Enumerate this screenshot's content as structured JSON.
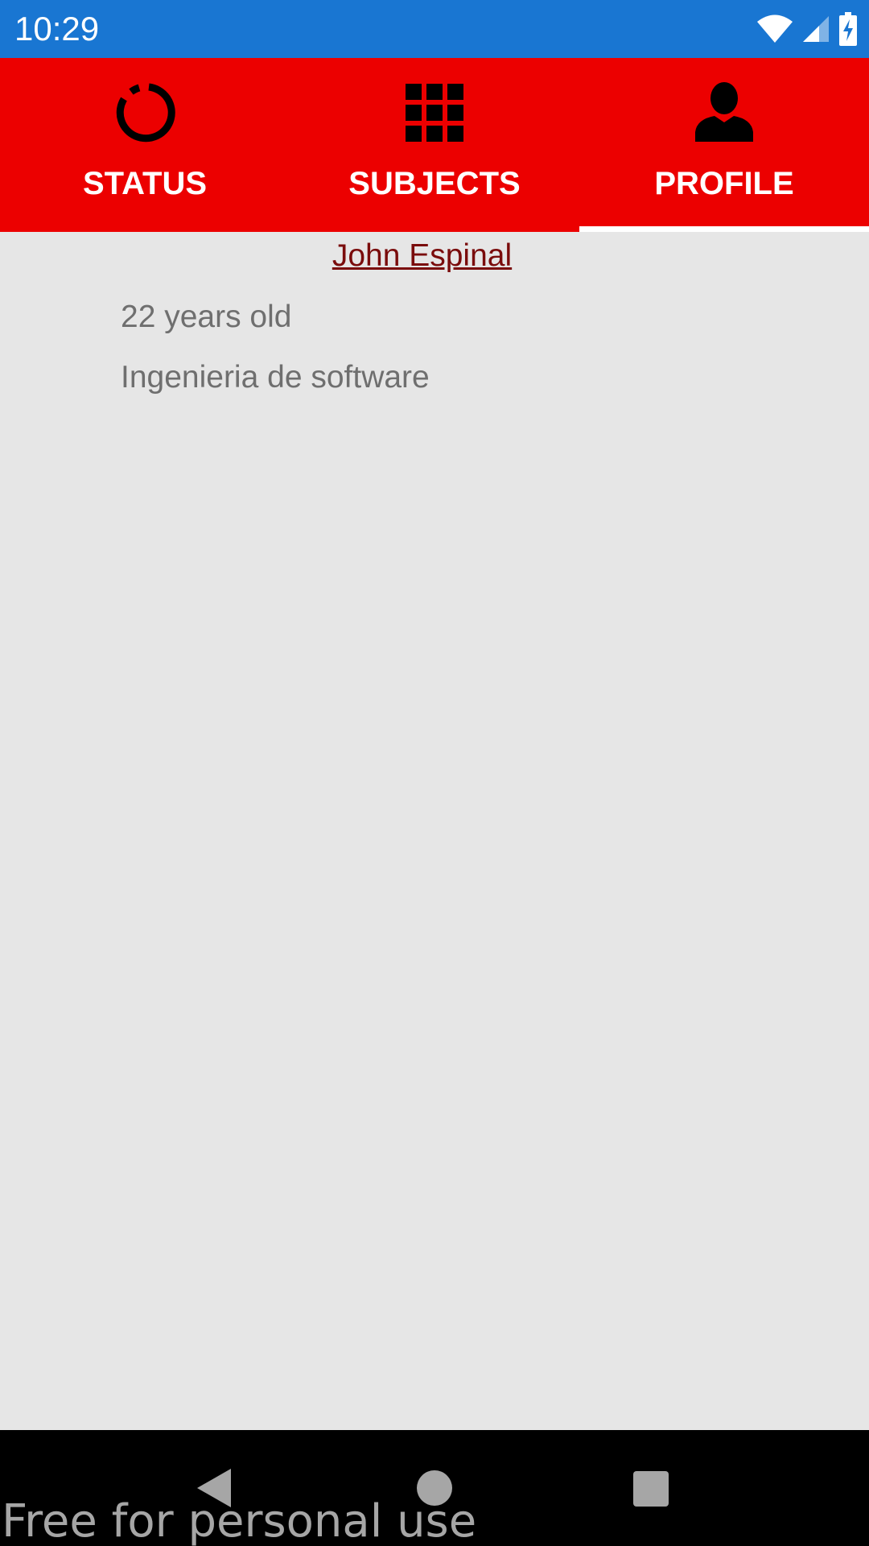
{
  "status_bar": {
    "time": "10:29",
    "icons": [
      "wifi-icon",
      "signal-icon",
      "battery-charging-icon"
    ],
    "background": "#1976d2"
  },
  "tabs": {
    "background": "#ec0000",
    "selected": "PROFILE",
    "items": [
      {
        "label": "STATUS",
        "icon": "circular-progress-icon"
      },
      {
        "label": "SUBJECTS",
        "icon": "grid-icon"
      },
      {
        "label": "PROFILE",
        "icon": "person-icon"
      }
    ]
  },
  "profile": {
    "name": "John Espinal",
    "age": "22 years old",
    "career": "Ingenieria de software"
  },
  "nav_bar": {
    "buttons": [
      "back-icon",
      "home-icon",
      "recents-icon"
    ]
  },
  "watermark": "Free for personal use"
}
